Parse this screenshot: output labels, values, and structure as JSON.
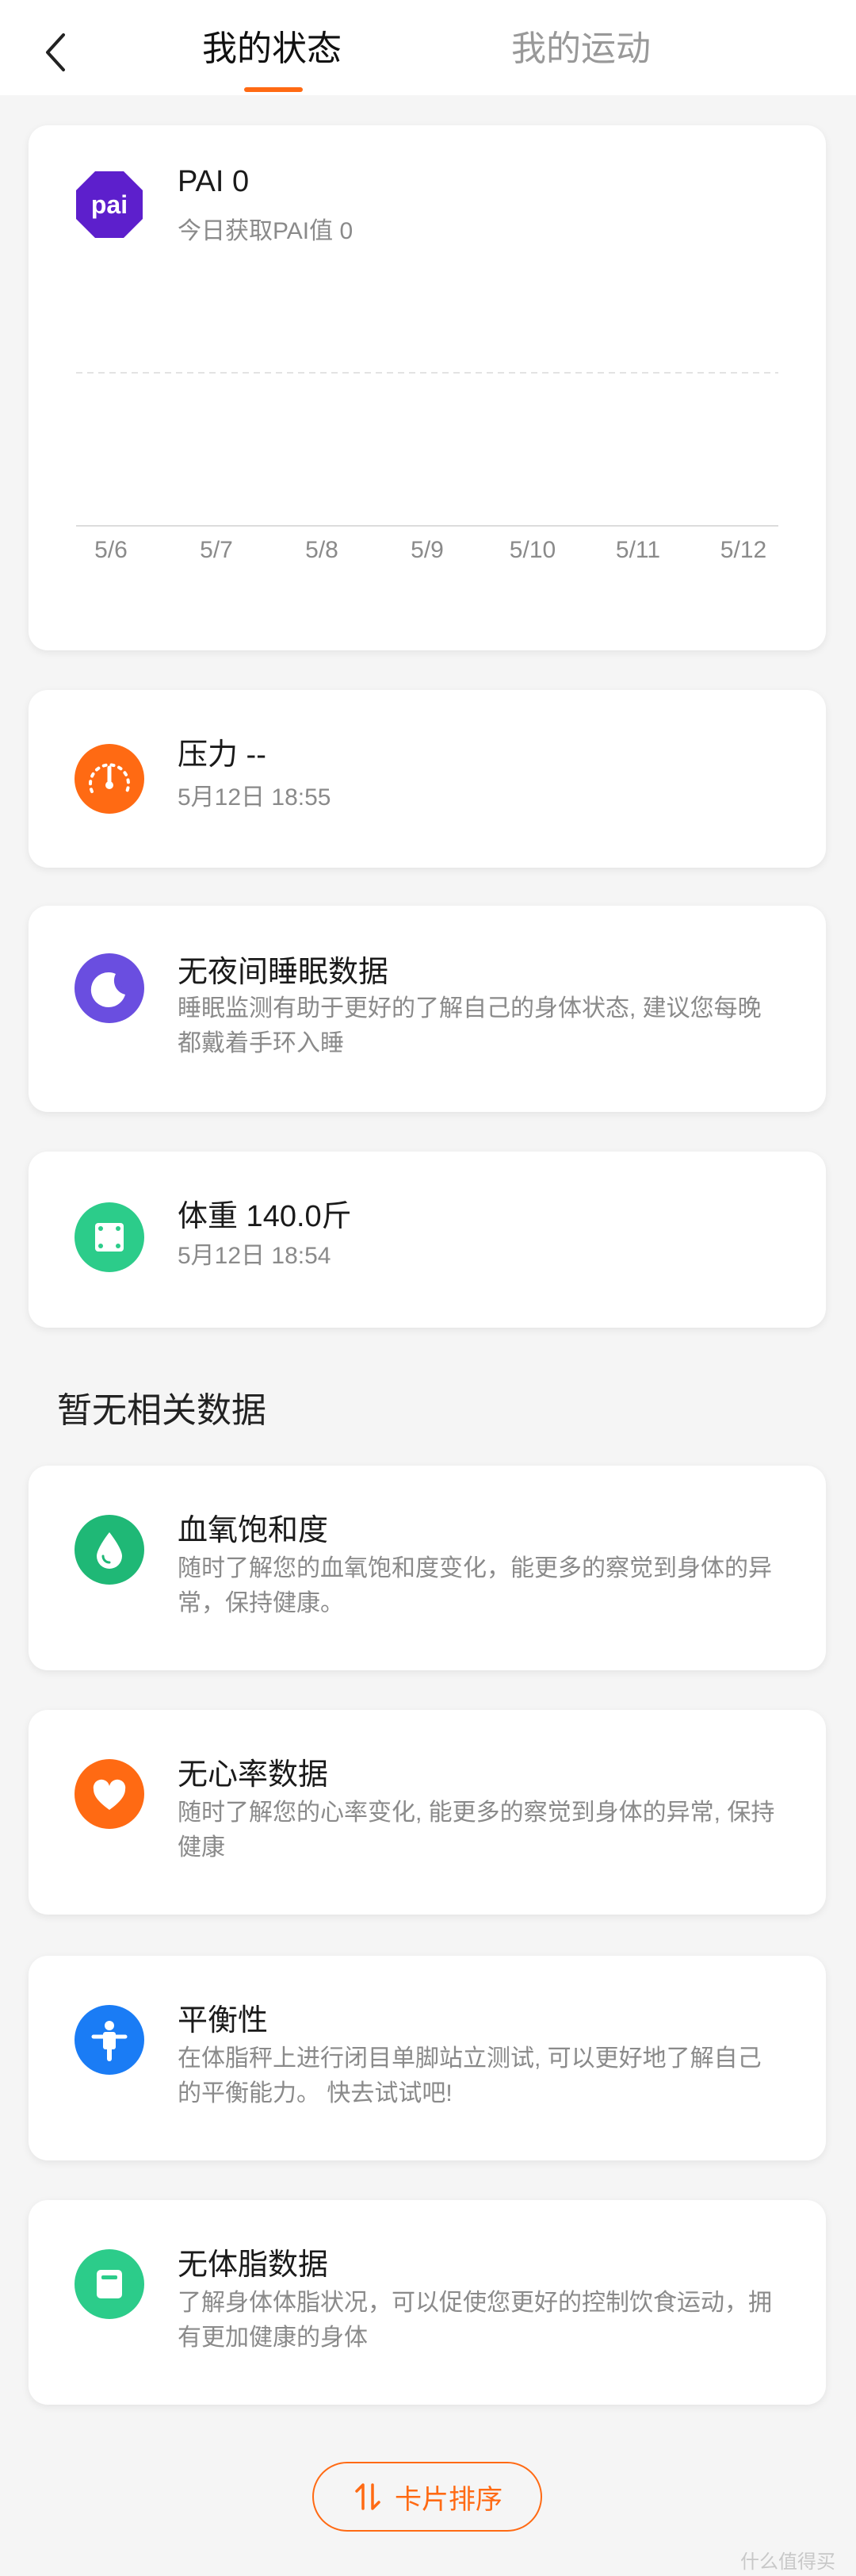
{
  "header": {
    "tab_status": "我的状态",
    "tab_sport": "我的运动",
    "active_tab": "我的状态",
    "back_icon": "chevron-left-icon"
  },
  "accent_color": "#ff6a13",
  "pai": {
    "icon_text": "pai",
    "title": "PAI 0",
    "subtitle": "今日获取PAI值 0",
    "chart_data": {
      "type": "bar",
      "categories": [
        "5/6",
        "5/7",
        "5/8",
        "5/9",
        "5/10",
        "5/11",
        "5/12"
      ],
      "values": [
        0,
        0,
        0,
        0,
        0,
        0,
        0
      ],
      "grid": true
    }
  },
  "cards": {
    "stress": {
      "title": "压力 --",
      "subtitle": "5月12日 18:55",
      "icon": "gauge-icon",
      "color": "#ff6a13"
    },
    "sleep": {
      "title": "无夜间睡眠数据",
      "subtitle": "睡眠监测有助于更好的了解自己的身体状态, 建议您每晚都戴着手环入睡",
      "icon": "moon-icon",
      "color": "#6a4ee0"
    },
    "weight": {
      "title": "体重 140.0斤",
      "subtitle": "5月12日 18:54",
      "icon": "scale-icon",
      "color": "#2ccc8a"
    }
  },
  "section_heading": "暂无相关数据",
  "no_data_cards": {
    "spo2": {
      "title": "血氧饱和度",
      "subtitle": "随时了解您的血氧饱和度变化，能更多的察觉到身体的异常，保持健康。",
      "icon": "blood-drop-icon",
      "color": "#1fb876"
    },
    "heart": {
      "title": "无心率数据",
      "subtitle": "随时了解您的心率变化, 能更多的察觉到身体的异常, 保持健康",
      "icon": "heart-icon",
      "color": "#ff6a13"
    },
    "balance": {
      "title": "平衡性",
      "subtitle": "在体脂秤上进行闭目单脚站立测试, 可以更好地了解自己的平衡能力。 快去试试吧!",
      "icon": "person-balance-icon",
      "color": "#1a7cf5"
    },
    "bodyfat": {
      "title": "无体脂数据",
      "subtitle": "了解身体体脂状况，可以促使您更好的控制饮食运动，拥有更加健康的身体",
      "icon": "body-fat-icon",
      "color": "#2ccc8a"
    }
  },
  "sort_button": {
    "label": "卡片排序",
    "icon": "sort-icon"
  },
  "watermark": "什么值得买"
}
